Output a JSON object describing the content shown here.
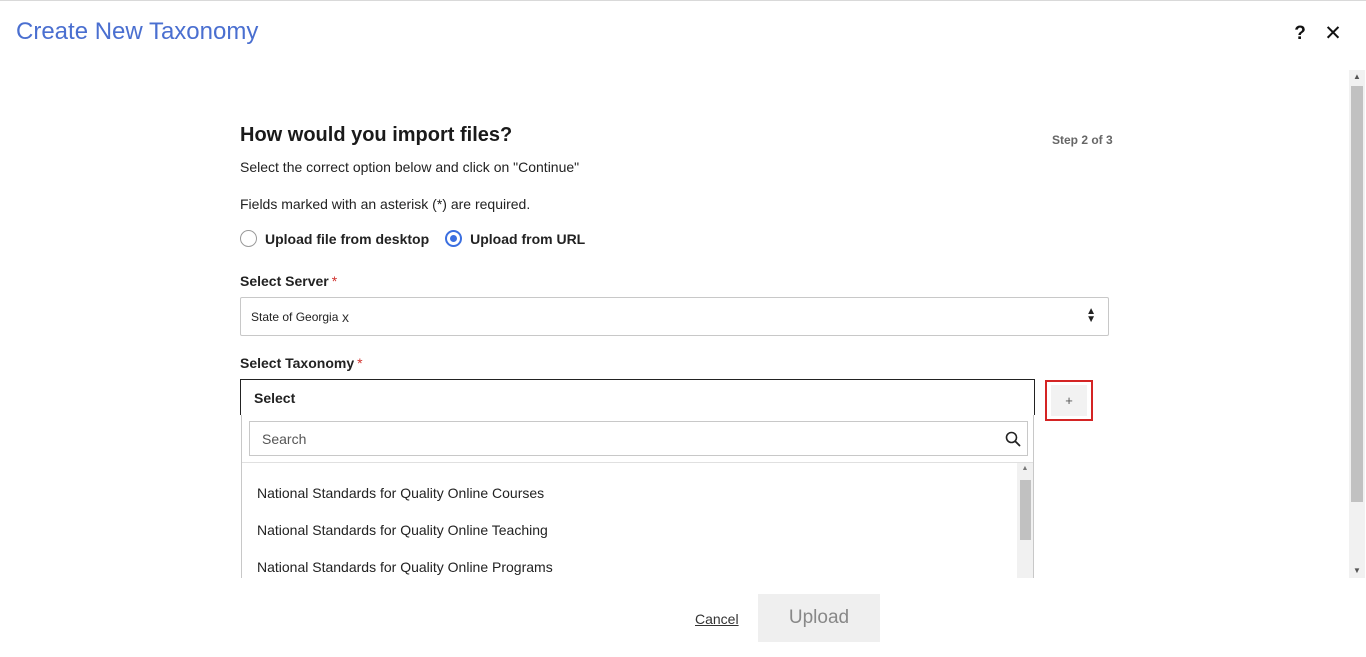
{
  "dialog": {
    "title": "Create New Taxonomy",
    "help_label": "?",
    "close_label": "✕"
  },
  "form": {
    "heading": "How would you import files?",
    "step": "Step 2 of 3",
    "instruction": "Select the correct option below and click on \"Continue\"",
    "required_note": "Fields marked with an asterisk (*) are required.",
    "import_options": [
      {
        "label": "Upload file from desktop",
        "selected": false
      },
      {
        "label": "Upload from URL",
        "selected": true
      }
    ],
    "server": {
      "label": "Select Server",
      "asterisk": "*",
      "value": "State of Georgia",
      "clear": "x"
    },
    "taxonomy": {
      "label": "Select Taxonomy",
      "asterisk": "*",
      "value": "Select",
      "add_label": "+",
      "search_placeholder": "Search",
      "options": [
        "National Standards for Quality Online Courses",
        "National Standards for Quality Online Teaching",
        "National Standards for Quality Online Programs"
      ]
    }
  },
  "footer": {
    "cancel_label": "Cancel",
    "upload_label": "Upload"
  },
  "colors": {
    "title": "#4a6fd0",
    "radio_selected": "#3b6fe0",
    "asterisk": "#d0312d",
    "highlight": "#d42424"
  },
  "icons": [
    "help-icon",
    "close-icon",
    "clear-x-icon",
    "sort-caret-icon",
    "plus-icon",
    "search-icon"
  ]
}
